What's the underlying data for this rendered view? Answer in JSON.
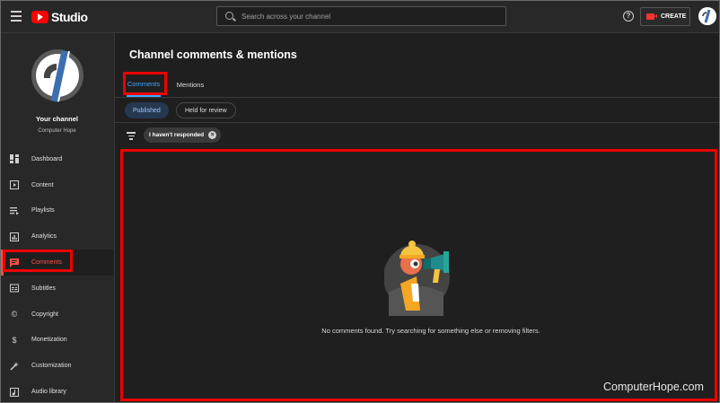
{
  "app": {
    "logo_text": "Studio",
    "search_placeholder": "Search across your channel",
    "create_label": "CREATE"
  },
  "sidebar": {
    "channel_label": "Your channel",
    "channel_name": "Computer Hope",
    "items": [
      {
        "label": "Dashboard",
        "icon": "dashboard-icon"
      },
      {
        "label": "Content",
        "icon": "content-icon"
      },
      {
        "label": "Playlists",
        "icon": "playlists-icon"
      },
      {
        "label": "Analytics",
        "icon": "analytics-icon"
      },
      {
        "label": "Comments",
        "icon": "comments-icon",
        "active": true
      },
      {
        "label": "Subtitles",
        "icon": "subtitles-icon"
      },
      {
        "label": "Copyright",
        "icon": "copyright-icon"
      },
      {
        "label": "Monetization",
        "icon": "monetization-icon"
      },
      {
        "label": "Customization",
        "icon": "customization-icon"
      },
      {
        "label": "Audio library",
        "icon": "audio-library-icon"
      }
    ]
  },
  "main": {
    "title": "Channel comments & mentions",
    "tabs": [
      {
        "label": "Comments",
        "selected": true
      },
      {
        "label": "Mentions",
        "selected": false
      }
    ],
    "chips": [
      {
        "label": "Published",
        "selected": true
      },
      {
        "label": "Held for review",
        "selected": false
      }
    ],
    "filter_chip": "I haven't responded",
    "empty_message": "No comments found. Try searching for something else or removing filters."
  },
  "watermark": "ComputerHope.com",
  "colors": {
    "accent_red": "#ff0000",
    "active_nav": "#ff4e45",
    "tab_blue": "#3ea6ff",
    "highlight_box": "#e00000"
  }
}
